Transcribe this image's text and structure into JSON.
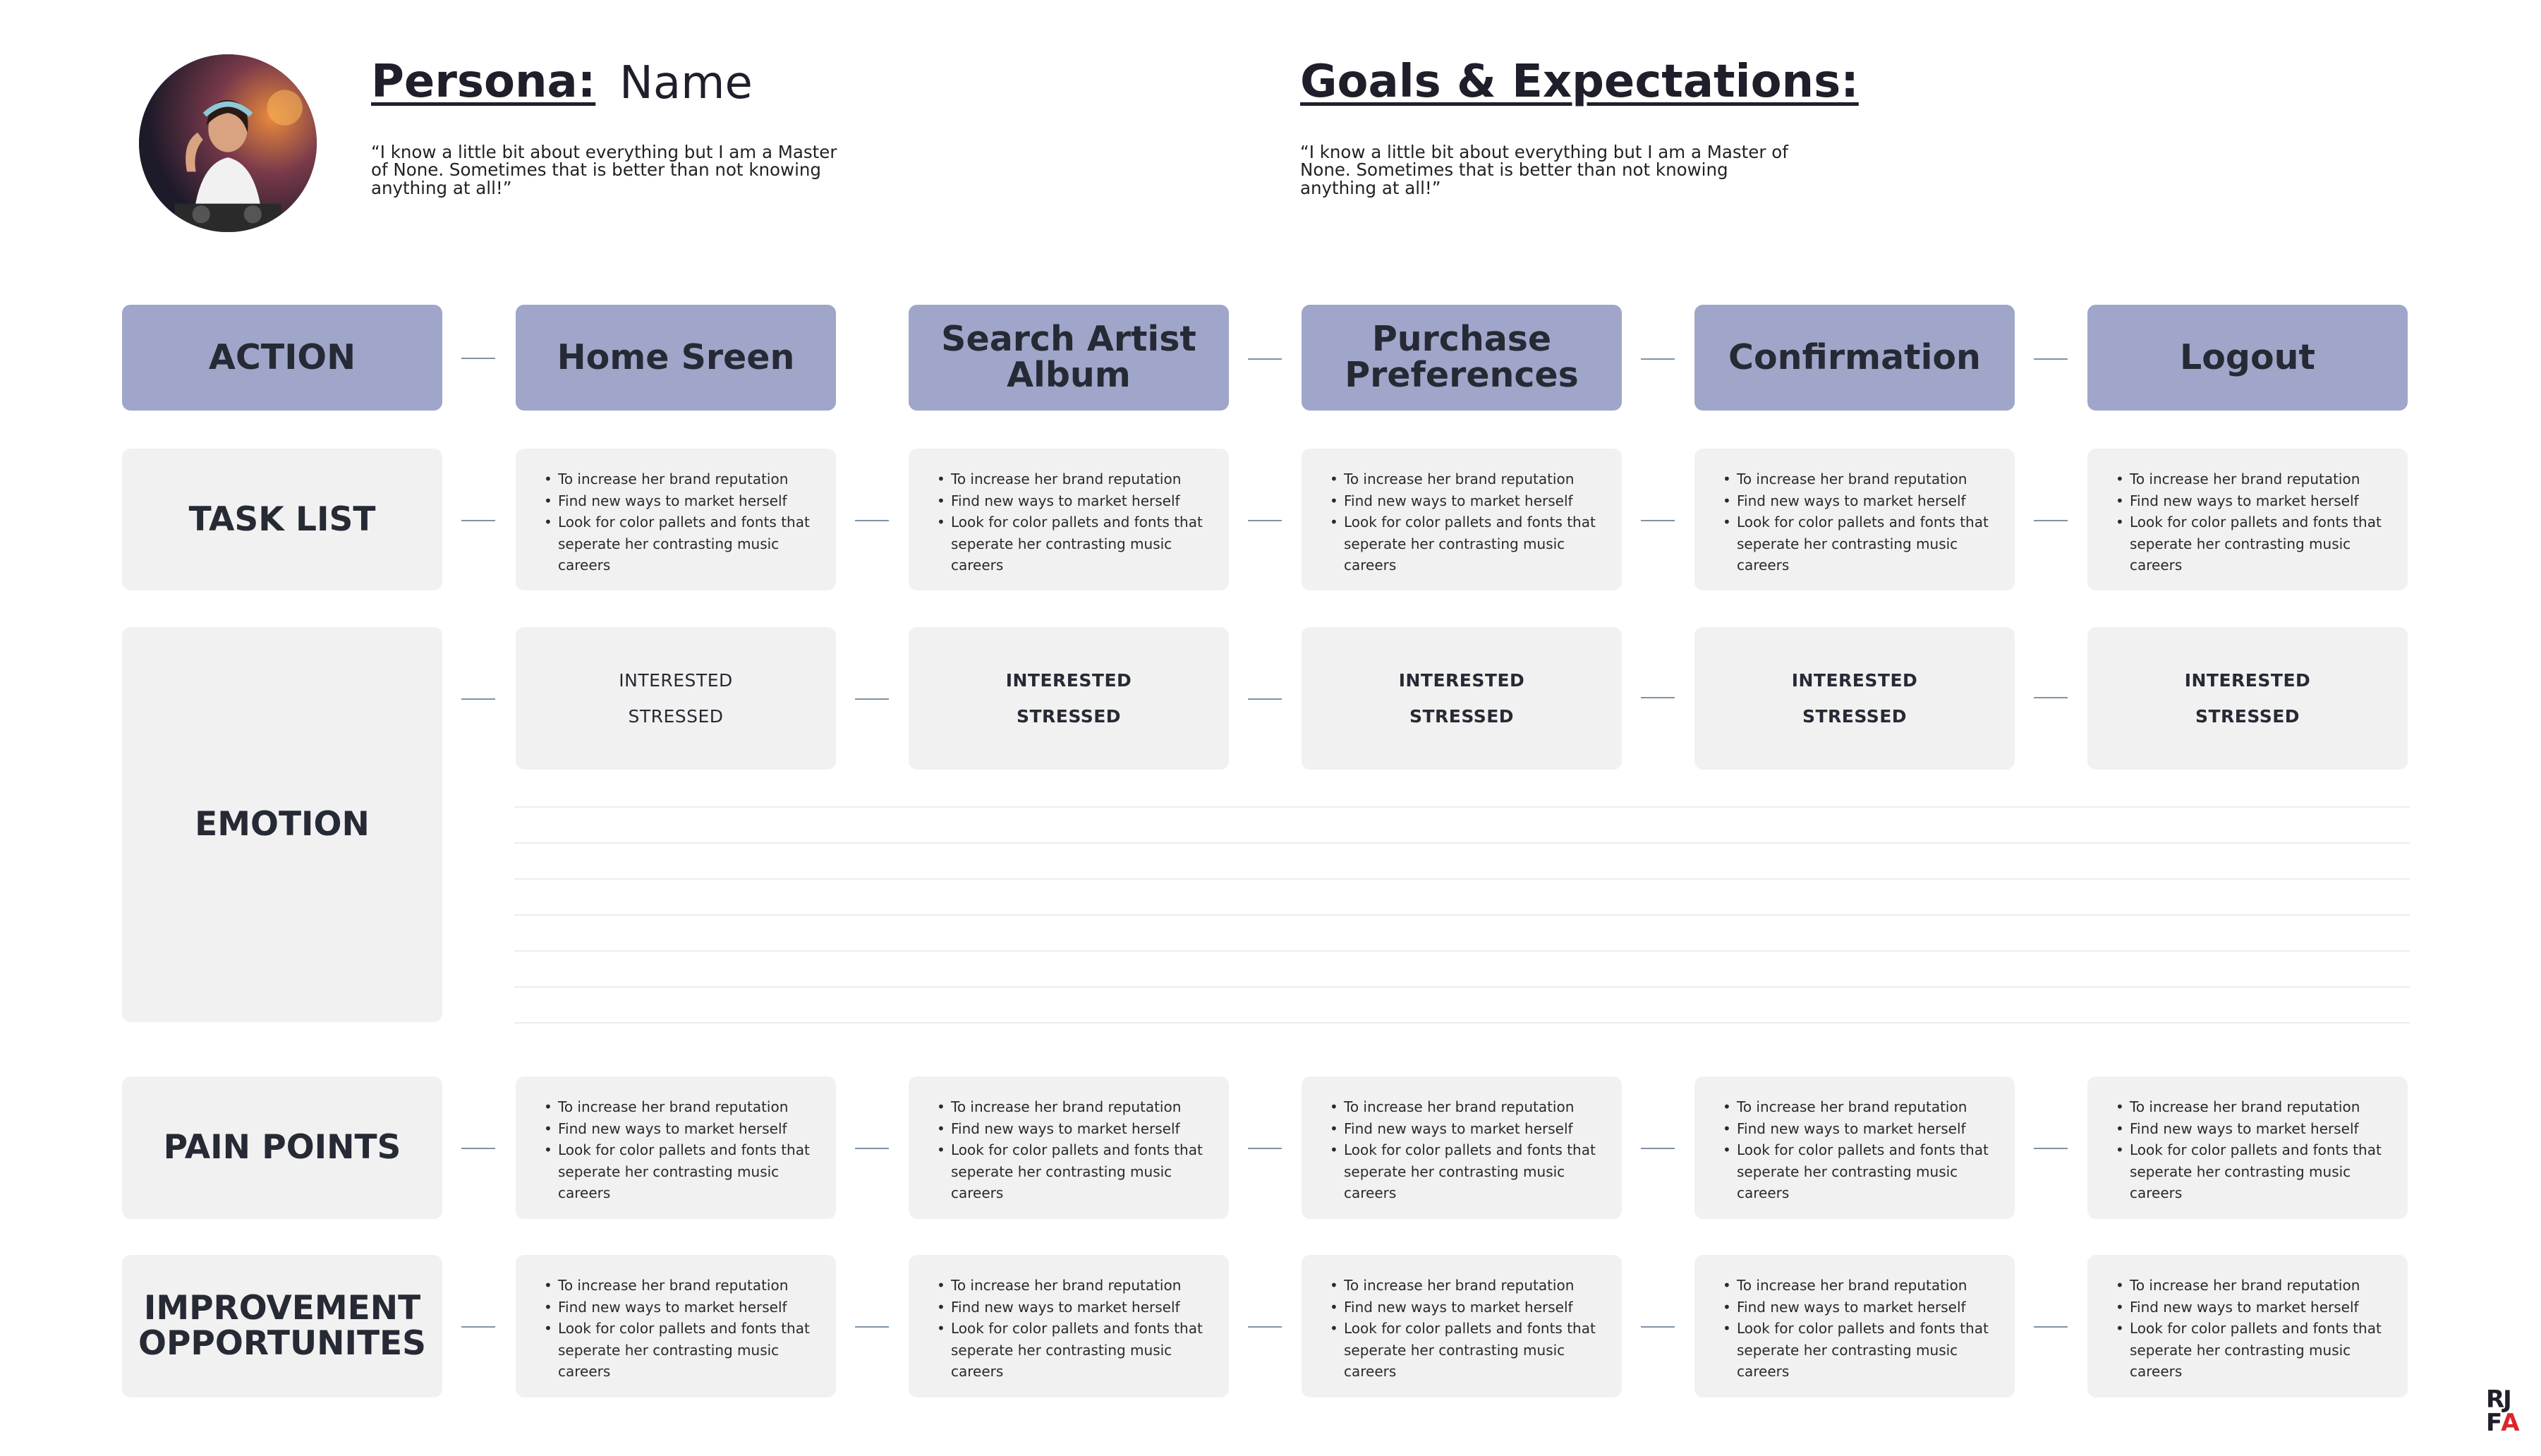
{
  "persona": {
    "label": "Persona:",
    "name": "Name",
    "quote": "“I know a little bit about everything but I am a Master of None. Sometimes that is  better than not knowing anything at all!”"
  },
  "goals": {
    "label": "Goals & Expectations:",
    "quote": "“I know a little bit about everything but I am a Master of None. Sometimes that is  better than not knowing anything at all!”"
  },
  "rows": {
    "action": "ACTION",
    "task_list": "TASK LIST",
    "emotion": "EMOTION",
    "pain_points": "PAIN POINTS",
    "improvement": "IMPROVEMENT OPPORTUNITES"
  },
  "stages": [
    "Home Sreen",
    "Search Artist Album",
    "Purchase Preferences",
    "Confirmation",
    "Logout"
  ],
  "bullets": [
    "To increase her brand reputation",
    "Find new ways to market herself",
    "Look for color pallets and fonts that seperate her contrasting music careers"
  ],
  "emotions": [
    "INTERESTED",
    "STRESSED"
  ],
  "logo": {
    "top": "RJ",
    "bottom_left": "F",
    "bottom_right": "A"
  },
  "colors": {
    "header": "#a0a6c9",
    "cell": "#f2f1f1",
    "logo_accent": "#d9262c"
  }
}
